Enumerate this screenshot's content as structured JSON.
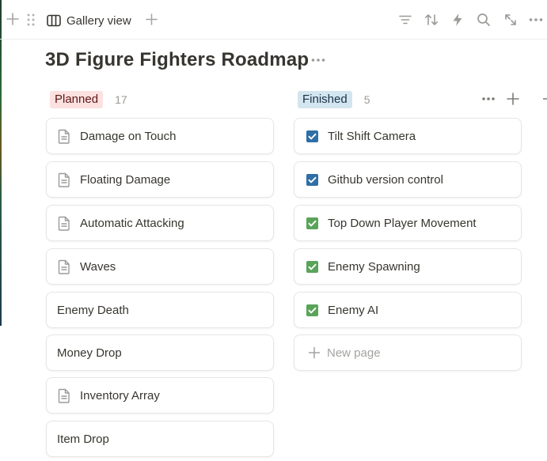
{
  "toolbar": {
    "view_label": "Gallery view"
  },
  "board": {
    "title": "3D Figure Fighters Roadmap"
  },
  "groups": [
    {
      "label": "Planned",
      "count": "17",
      "color": "#fbe1e0",
      "cards": [
        {
          "title": "Damage on Touch",
          "icon": "page-icon"
        },
        {
          "title": "Floating Damage",
          "icon": "page-icon"
        },
        {
          "title": "Automatic Attacking",
          "icon": "page-icon"
        },
        {
          "title": "Waves",
          "icon": "page-icon"
        },
        {
          "title": "Enemy Death",
          "icon": ""
        },
        {
          "title": "Money Drop",
          "icon": ""
        },
        {
          "title": "Inventory Array",
          "icon": "page-icon"
        },
        {
          "title": "Item Drop",
          "icon": ""
        }
      ]
    },
    {
      "label": "Finished",
      "count": "5",
      "color": "#d3e5ef",
      "cards": [
        {
          "title": "Tilt Shift Camera",
          "icon": "checkbox-blue-icon"
        },
        {
          "title": "Github version control",
          "icon": "checkbox-blue-icon"
        },
        {
          "title": "Top Down Player Movement",
          "icon": "checkbox-green-icon"
        },
        {
          "title": "Enemy Spawning",
          "icon": "checkbox-green-icon"
        },
        {
          "title": "Enemy AI",
          "icon": "checkbox-green-icon"
        }
      ],
      "new_page_label": "New page"
    }
  ],
  "colors": {
    "checkbox_blue": "#2f6fa6",
    "checkbox_green": "#5aa45a",
    "text": "#37352f",
    "muted": "#9b9a97"
  }
}
